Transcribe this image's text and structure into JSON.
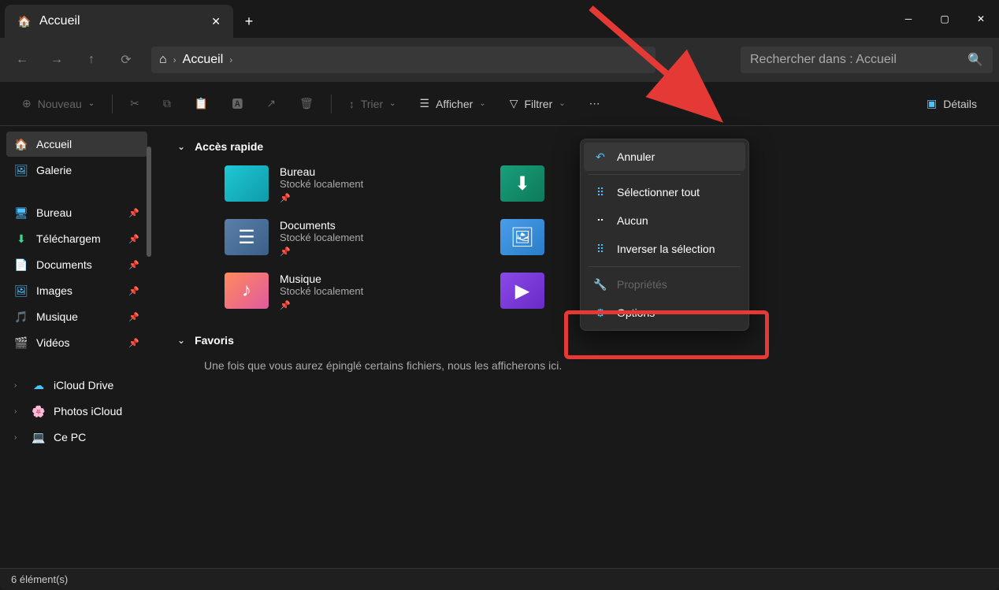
{
  "titlebar": {
    "tab_label": "Accueil",
    "newtab_icon": "+"
  },
  "navbar": {
    "breadcrumb": "Accueil",
    "search_placeholder": "Rechercher dans : Accueil"
  },
  "toolbar": {
    "new_label": "Nouveau",
    "sort_label": "Trier",
    "view_label": "Afficher",
    "filter_label": "Filtrer",
    "details_label": "Détails"
  },
  "sidebar": {
    "items": [
      {
        "label": "Accueil"
      },
      {
        "label": "Galerie"
      },
      {
        "label": "Bureau"
      },
      {
        "label": "Téléchargem"
      },
      {
        "label": "Documents"
      },
      {
        "label": "Images"
      },
      {
        "label": "Musique"
      },
      {
        "label": "Vidéos"
      },
      {
        "label": "iCloud Drive"
      },
      {
        "label": "Photos iCloud"
      },
      {
        "label": "Ce PC"
      }
    ]
  },
  "main": {
    "section_quick": "Accès rapide",
    "section_fav": "Favoris",
    "fav_empty": "Une fois que vous aurez épinglé certains fichiers, nous les afficherons ici.",
    "stored_locally": "Stocké localement",
    "folders": [
      {
        "name": "Bureau"
      },
      {
        "name": "Documents"
      },
      {
        "name": "Musique"
      }
    ]
  },
  "ctx": {
    "undo": "Annuler",
    "select_all": "Sélectionner tout",
    "none": "Aucun",
    "invert": "Inverser la sélection",
    "properties": "Propriétés",
    "options": "Options"
  },
  "status": {
    "count": "6 élément(s)"
  }
}
